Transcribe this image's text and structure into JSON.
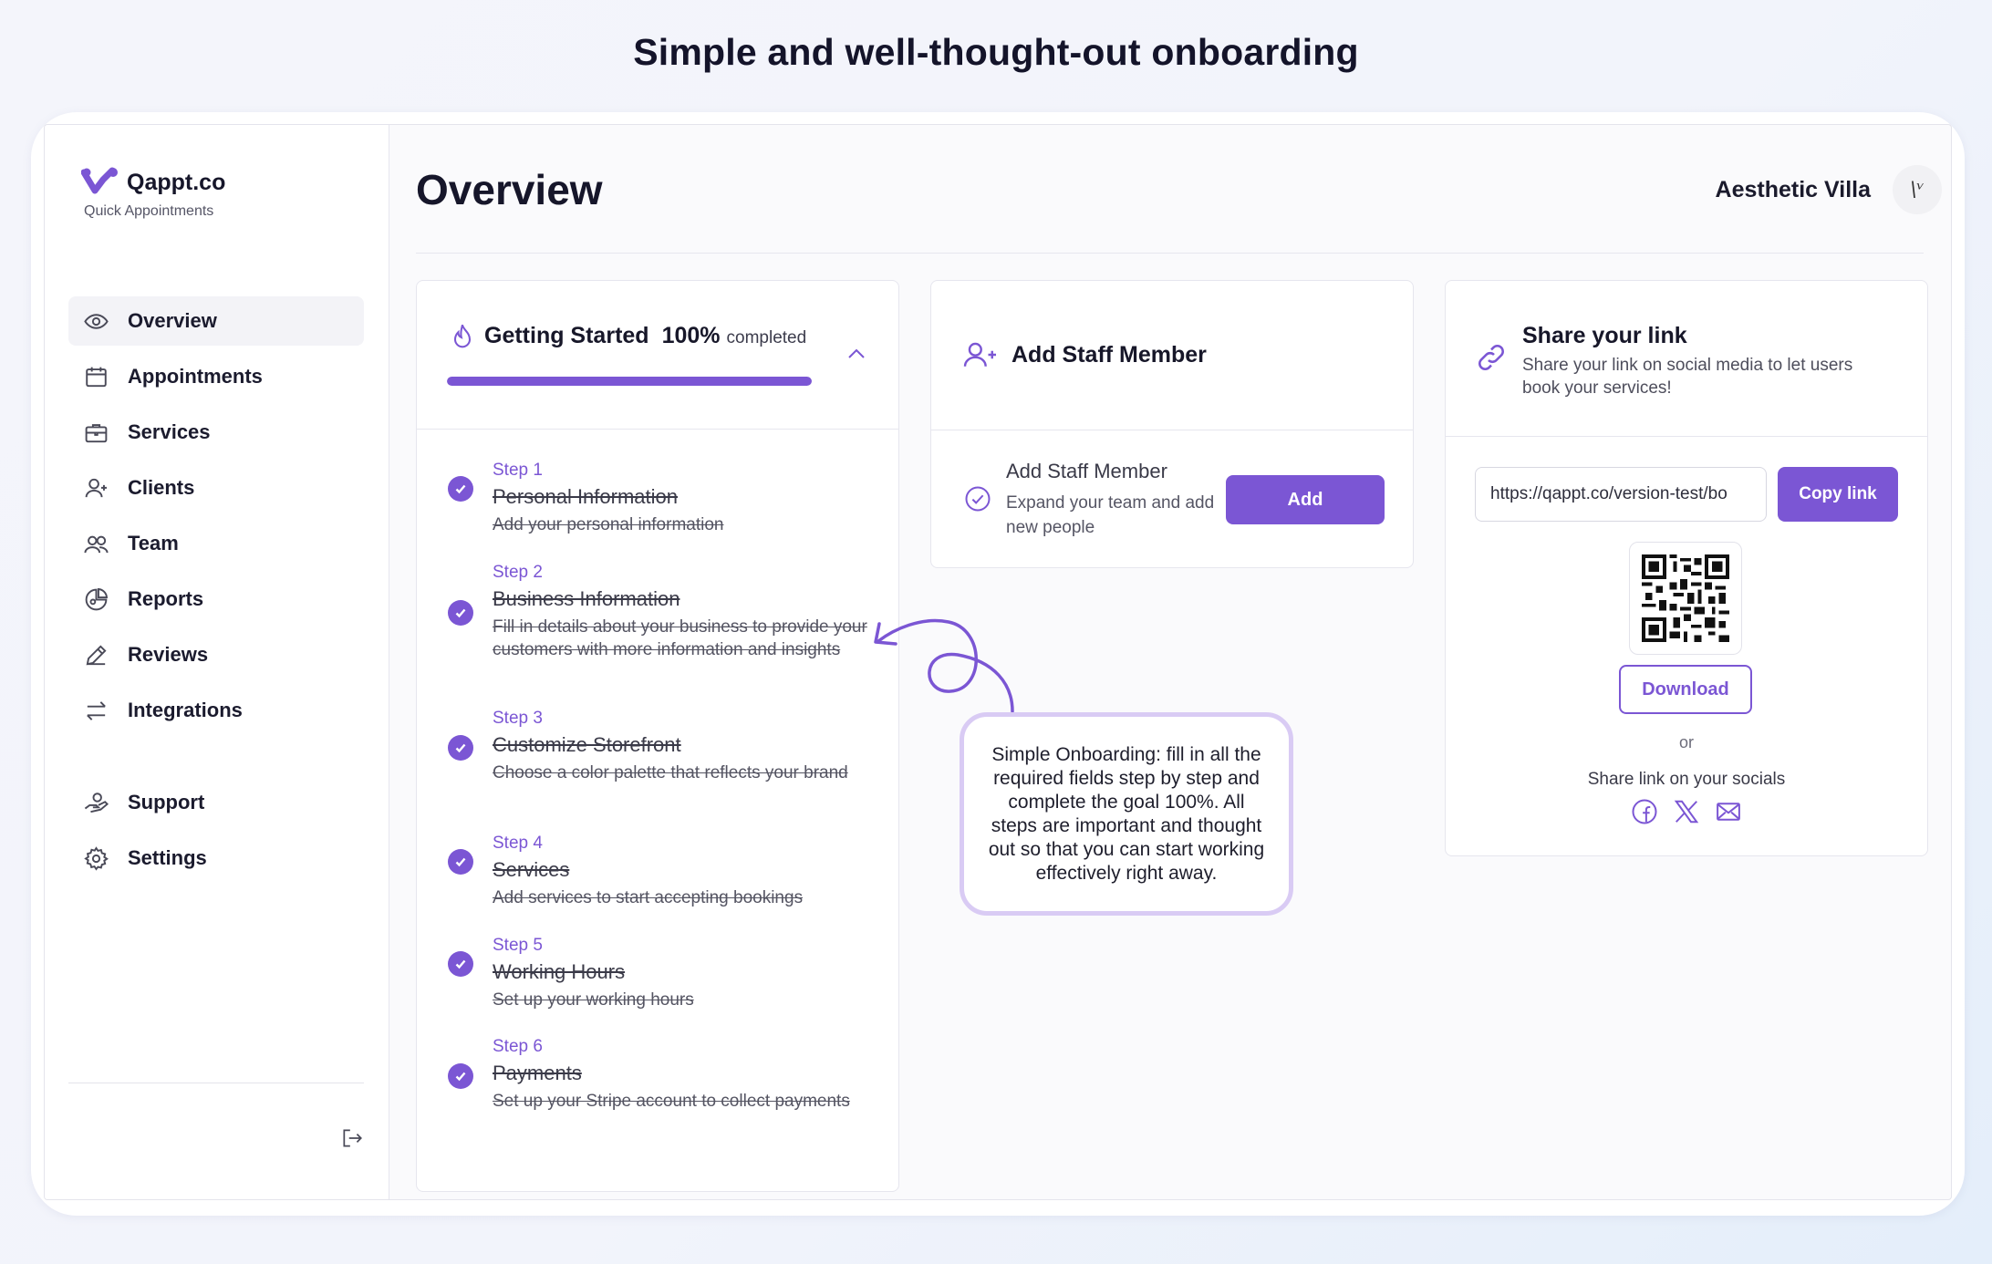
{
  "headline": "Simple and well-thought-out onboarding",
  "brand": {
    "name": "Qappt.co",
    "tagline": "Quick Appointments",
    "accent": "#7b56d4"
  },
  "sidebar": {
    "items": [
      {
        "label": "Overview",
        "icon": "eye-icon",
        "active": true
      },
      {
        "label": "Appointments",
        "icon": "calendar-icon"
      },
      {
        "label": "Services",
        "icon": "briefcase-icon"
      },
      {
        "label": "Clients",
        "icon": "user-plus-icon"
      },
      {
        "label": "Team",
        "icon": "users-icon"
      },
      {
        "label": "Reports",
        "icon": "pie-chart-icon"
      },
      {
        "label": "Reviews",
        "icon": "pencil-icon"
      },
      {
        "label": "Integrations",
        "icon": "arrows-swap-icon"
      }
    ],
    "bottom_items": [
      {
        "label": "Support",
        "icon": "support-icon"
      },
      {
        "label": "Settings",
        "icon": "gear-icon"
      }
    ],
    "logout_icon": "logout-icon"
  },
  "header": {
    "title": "Overview",
    "account_name": "Aesthetic Villa",
    "avatar_text": "\\ᵛ"
  },
  "getting_started": {
    "title": "Getting Started",
    "percent": "100%",
    "completed_label": "completed",
    "progress": 1.0,
    "steps": [
      {
        "num": "Step 1",
        "name": "Personal Information",
        "desc": "Add your personal information"
      },
      {
        "num": "Step 2",
        "name": "Business Information",
        "desc": "Fill in details about your business to provide your customers with more information and insights"
      },
      {
        "num": "Step 3",
        "name": "Customize Storefront",
        "desc": "Choose a color palette that reflects your brand"
      },
      {
        "num": "Step 4",
        "name": "Services",
        "desc": "Add services to start accepting bookings"
      },
      {
        "num": "Step 5",
        "name": "Working Hours",
        "desc": "Set up your working hours"
      },
      {
        "num": "Step 6",
        "name": "Payments",
        "desc": "Set up your Stripe account to collect payments"
      }
    ]
  },
  "staff": {
    "title": "Add Staff Member",
    "item_title": "Add Staff Member",
    "item_desc": "Expand your team and add new people",
    "add_label": "Add"
  },
  "share": {
    "title": "Share your link",
    "desc": "Share your link on social media to let users book your services!",
    "link_value": "https://qappt.co/version-test/bo",
    "copy_label": "Copy link",
    "download_label": "Download",
    "or_label": "or",
    "socials_label": "Share link on your socials",
    "socials": [
      "facebook-icon",
      "x-icon",
      "mail-icon"
    ]
  },
  "annotation": {
    "text": "Simple Onboarding: fill in all the required fields step by step and complete the goal 100%. All steps are important and thought out so that you can start working effectively right away."
  }
}
